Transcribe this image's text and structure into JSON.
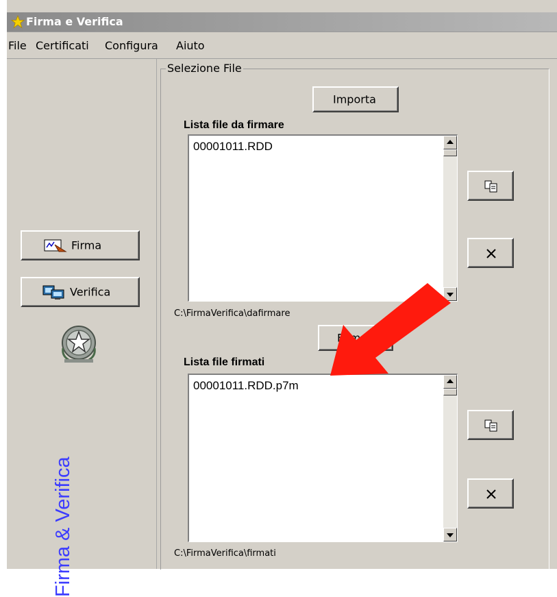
{
  "window": {
    "title": "Firma e Verifica"
  },
  "menu": [
    "File",
    "Certificati",
    "Configura",
    "Aiuto"
  ],
  "left": {
    "firma_label": "Firma",
    "verifica_label": "Verifica",
    "vertical_title": "Firma & Verifica"
  },
  "selection": {
    "group_label": "Selezione File",
    "import_label": "Importa",
    "sign_label": "Firma",
    "to_sign": {
      "title": "Lista file da firmare",
      "items": [
        "00001011.RDD"
      ],
      "path": "C:\\FirmaVerifica\\dafirmare"
    },
    "signed": {
      "title": "Lista file firmati",
      "items": [
        "00001011.RDD.p7m"
      ],
      "path": "C:\\FirmaVerifica\\firmati"
    }
  },
  "colors": {
    "accent_text": "#3c3cff",
    "annotation_arrow": "#ff0000"
  }
}
